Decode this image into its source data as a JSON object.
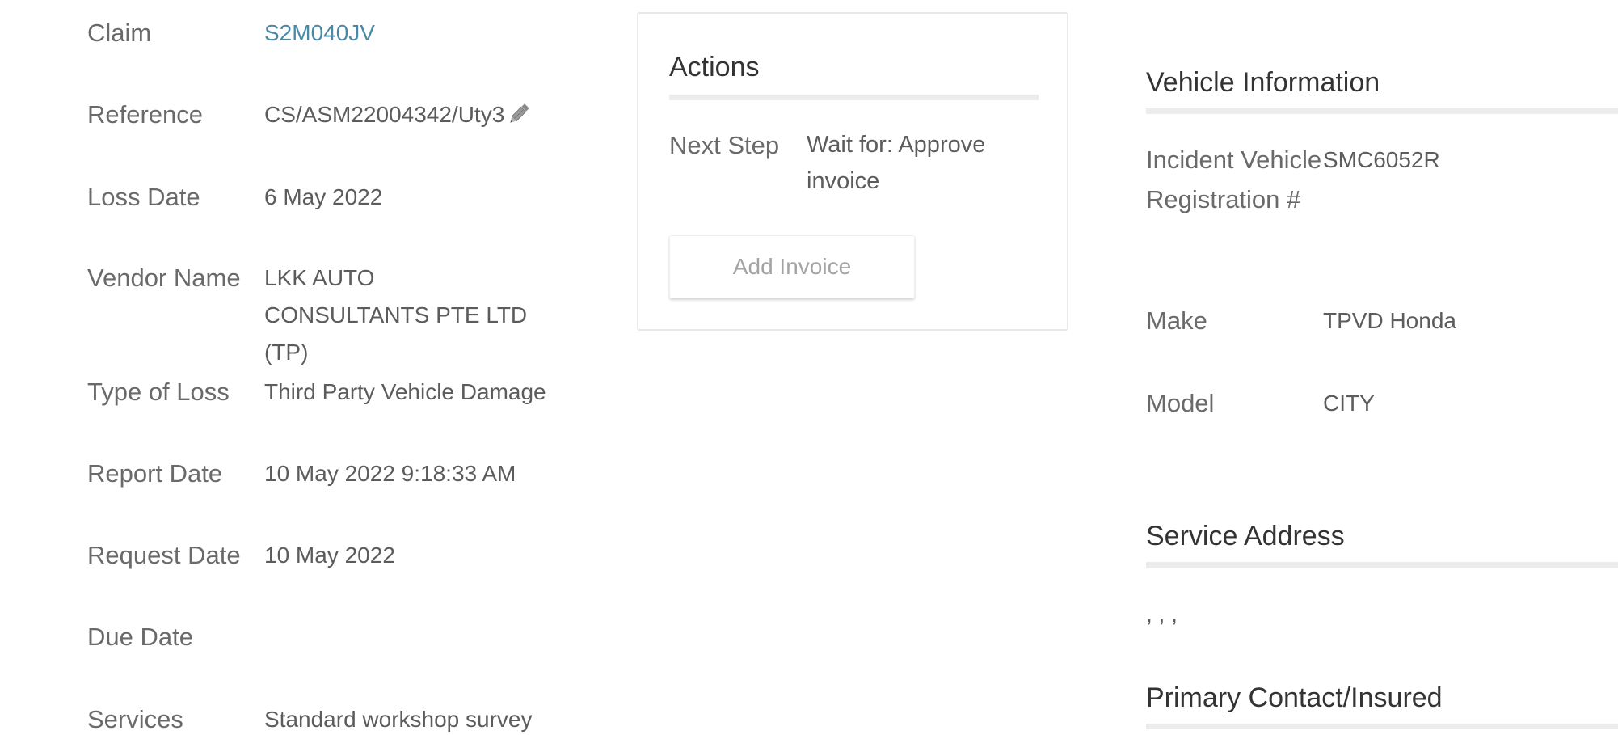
{
  "details": {
    "claim_label": "Claim",
    "claim_value": "S2M040JV",
    "reference_label": "Reference",
    "reference_value": "CS/ASM22004342/Uty3",
    "loss_date_label": "Loss Date",
    "loss_date_value": "6 May 2022",
    "vendor_label": "Vendor Name",
    "vendor_value": "LKK AUTO CONSULTANTS PTE LTD (TP)",
    "type_of_loss_label": "Type of Loss",
    "type_of_loss_value": "Third Party Vehicle Damage",
    "report_date_label": "Report Date",
    "report_date_value": "10 May 2022 9:18:33 AM",
    "request_date_label": "Request Date",
    "request_date_value": "10 May 2022",
    "due_date_label": "Due Date",
    "due_date_value": "",
    "services_label": "Services",
    "services_value": "Standard workshop survey"
  },
  "actions": {
    "title": "Actions",
    "next_step_label": "Next Step",
    "next_step_value": "Wait for: Approve invoice",
    "add_invoice_label": "Add Invoice"
  },
  "vehicle": {
    "title": "Vehicle Information",
    "registration_label": "Incident Vehicle Registration #",
    "registration_value": "SMC6052R",
    "make_label": "Make",
    "make_value": "TPVD Honda",
    "model_label": "Model",
    "model_value": "CITY"
  },
  "service_address": {
    "title": "Service Address",
    "value": ", , ,"
  },
  "primary_contact": {
    "title": "Primary Contact/Insured"
  },
  "icons": {
    "edit_reference": "pencil-icon"
  },
  "colors": {
    "link": "#4a88a8",
    "rule": "#ececec"
  }
}
